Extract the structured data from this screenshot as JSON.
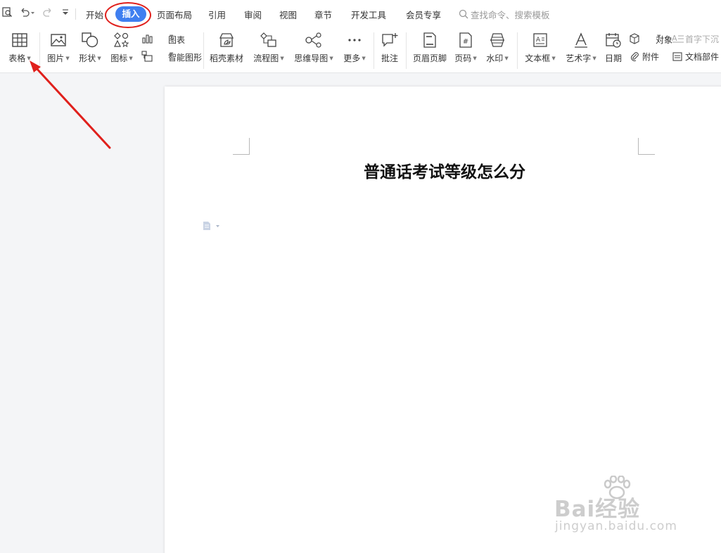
{
  "menu": {
    "tabs": [
      "开始",
      "插入",
      "页面布局",
      "引用",
      "审阅",
      "视图",
      "章节",
      "开发工具",
      "会员专享"
    ],
    "active_tab": "插入",
    "search_placeholder": "查找命令、搜索模板"
  },
  "ribbon": {
    "table": "表格",
    "picture": "图片",
    "shape": "形状",
    "icon": "图标",
    "chart": "图表",
    "smart_shape": "智能图形",
    "daoke": "稻壳素材",
    "flowchart": "流程图",
    "mindmap": "思维导图",
    "more": "更多",
    "comment": "批注",
    "header_footer": "页眉页脚",
    "page_number": "页码",
    "watermark": "水印",
    "textbox": "文本框",
    "wordart": "艺术字",
    "date": "日期",
    "object": "对象",
    "attachment": "附件",
    "drop_cap": "首字下沉",
    "doc_parts": "文档部件"
  },
  "document": {
    "title": "普通话考试等级怎么分"
  },
  "watermark": {
    "brand": "Bai经验",
    "url": "jingyan.baidu.com"
  },
  "colors": {
    "accent": "#3f7ff0",
    "annotation": "#e0201c"
  }
}
